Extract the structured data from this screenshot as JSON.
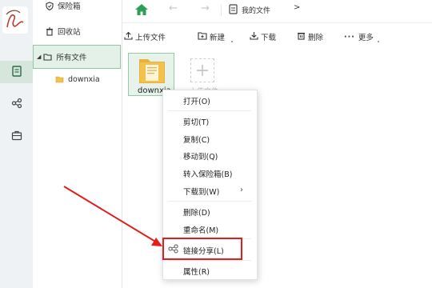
{
  "tree": {
    "vault": "保险箱",
    "recycle": "回收站",
    "all_files": "所有文件",
    "downxia": "downxia"
  },
  "nav": {
    "breadcrumb": "我的文件",
    "chevron": ">"
  },
  "toolbar": {
    "upload": "上传文件",
    "new": "新建",
    "download": "下载",
    "delete": "删除",
    "more": "更多"
  },
  "files": [
    {
      "name": "downxia"
    }
  ],
  "upload_tile": {
    "label": "上传文件"
  },
  "context_menu": {
    "open": "打开(O)",
    "cut": "剪切(T)",
    "copy": "复制(C)",
    "move": "移动到(Q)",
    "to_vault": "转入保险箱(B)",
    "download_to": "下载到(W)",
    "delete": "删除(D)",
    "rename": "重命名(M)",
    "link_share": "链接分享(L)",
    "properties": "属性(R)"
  },
  "colors": {
    "accent_green": "#2e9e55",
    "highlight_red": "#e31c1c",
    "selected_bg": "#e4f1e8",
    "folder_yellow": "#f2c14e"
  }
}
